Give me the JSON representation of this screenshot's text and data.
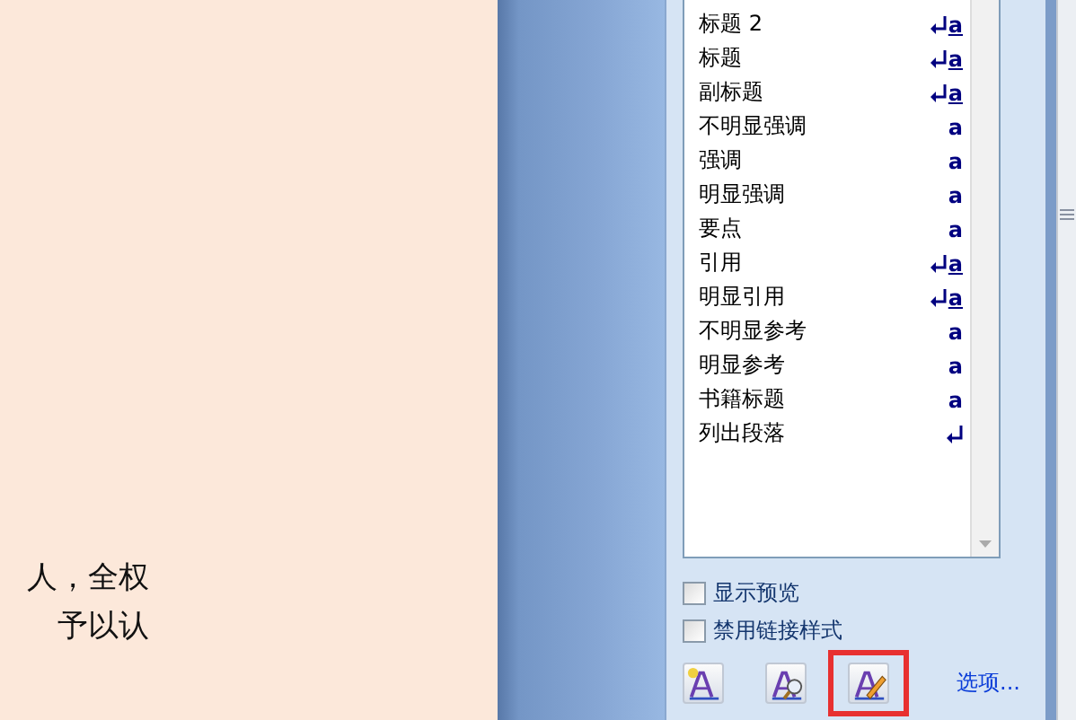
{
  "document": {
    "lines": [
      "人，全权",
      "予以认"
    ]
  },
  "styles_pane": {
    "items": [
      {
        "name": "标题 2",
        "kind": "para-char",
        "symbol": "a"
      },
      {
        "name": "标题",
        "kind": "para-char",
        "symbol": "a"
      },
      {
        "name": "副标题",
        "kind": "para-char",
        "symbol": "a"
      },
      {
        "name": "不明显强调",
        "kind": "char",
        "symbol": "a"
      },
      {
        "name": "强调",
        "kind": "char",
        "symbol": "a"
      },
      {
        "name": "明显强调",
        "kind": "char",
        "symbol": "a"
      },
      {
        "name": "要点",
        "kind": "char",
        "symbol": "a"
      },
      {
        "name": "引用",
        "kind": "para-char",
        "symbol": "a"
      },
      {
        "name": "明显引用",
        "kind": "para-char",
        "symbol": "a"
      },
      {
        "name": "不明显参考",
        "kind": "char",
        "symbol": "a"
      },
      {
        "name": "明显参考",
        "kind": "char",
        "symbol": "a"
      },
      {
        "name": "书籍标题",
        "kind": "char",
        "symbol": "a"
      },
      {
        "name": "列出段落",
        "kind": "para"
      }
    ],
    "options": [
      {
        "label": "显示预览",
        "checked": false
      },
      {
        "label": "禁用链接样式",
        "checked": false
      }
    ],
    "buttons": [
      {
        "kind": "new-style",
        "highlighted": false
      },
      {
        "kind": "inspector",
        "highlighted": false
      },
      {
        "kind": "manage",
        "highlighted": true
      }
    ],
    "link": "选项..."
  }
}
